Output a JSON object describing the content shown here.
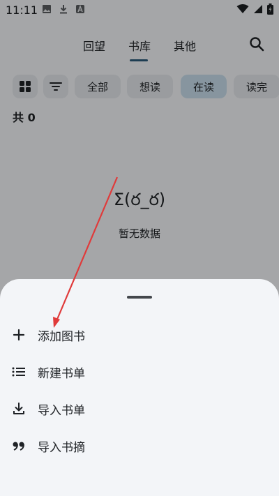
{
  "status_bar": {
    "time": "11:11"
  },
  "tabs": [
    {
      "label": "回望"
    },
    {
      "label": "书库"
    },
    {
      "label": "其他"
    }
  ],
  "filters": {
    "chips": [
      {
        "label": "全部"
      },
      {
        "label": "想读"
      },
      {
        "label": "在读"
      },
      {
        "label": "读完"
      }
    ],
    "active_chip": "在读"
  },
  "count_label": "共 0",
  "empty_state": {
    "face": "Σ(ర_ర)",
    "text": "暂无数据"
  },
  "sheet": {
    "items": [
      {
        "label": "添加图书",
        "icon": "plus-icon"
      },
      {
        "label": "新建书单",
        "icon": "list-icon"
      },
      {
        "label": "导入书单",
        "icon": "download-icon"
      },
      {
        "label": "导入书摘",
        "icon": "quote-icon"
      }
    ]
  },
  "colors": {
    "accent": "#2b5a7a",
    "active_chip": "#c8dcea",
    "annotation_arrow": "#e03a3a"
  }
}
